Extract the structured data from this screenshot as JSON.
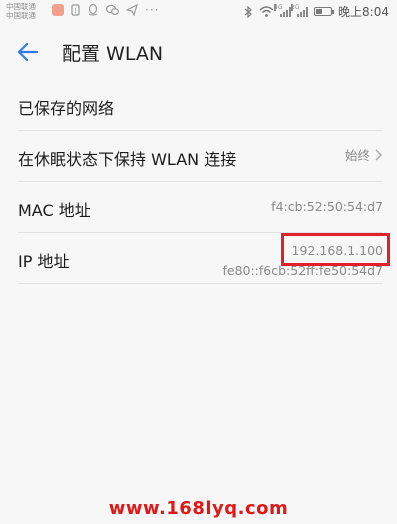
{
  "status_bar": {
    "carrier_1": "中国联通",
    "carrier_2": "中国联通",
    "more": "···",
    "signal_1_tag": "4G",
    "signal_2_tag": "2G",
    "battery_level": 0.45,
    "time": "晚上8:04"
  },
  "header": {
    "title": "配置 WLAN"
  },
  "settings": [
    {
      "label": "已保存的网络",
      "value": ""
    },
    {
      "label": "在休眠状态下保持 WLAN 连接",
      "value": "始终"
    },
    {
      "label": "MAC 地址",
      "value": "f4:cb:52:50:54:d7"
    },
    {
      "label": "IP 地址",
      "ipv4": "192.168.1.100",
      "ipv6": "fe80::f6cb:52ff:fe50:54d7"
    }
  ],
  "watermark": "www.168lyq.com",
  "colors": {
    "accent": "#2f7ce8",
    "highlight": "#e0202a",
    "watermark": "#e01818"
  }
}
